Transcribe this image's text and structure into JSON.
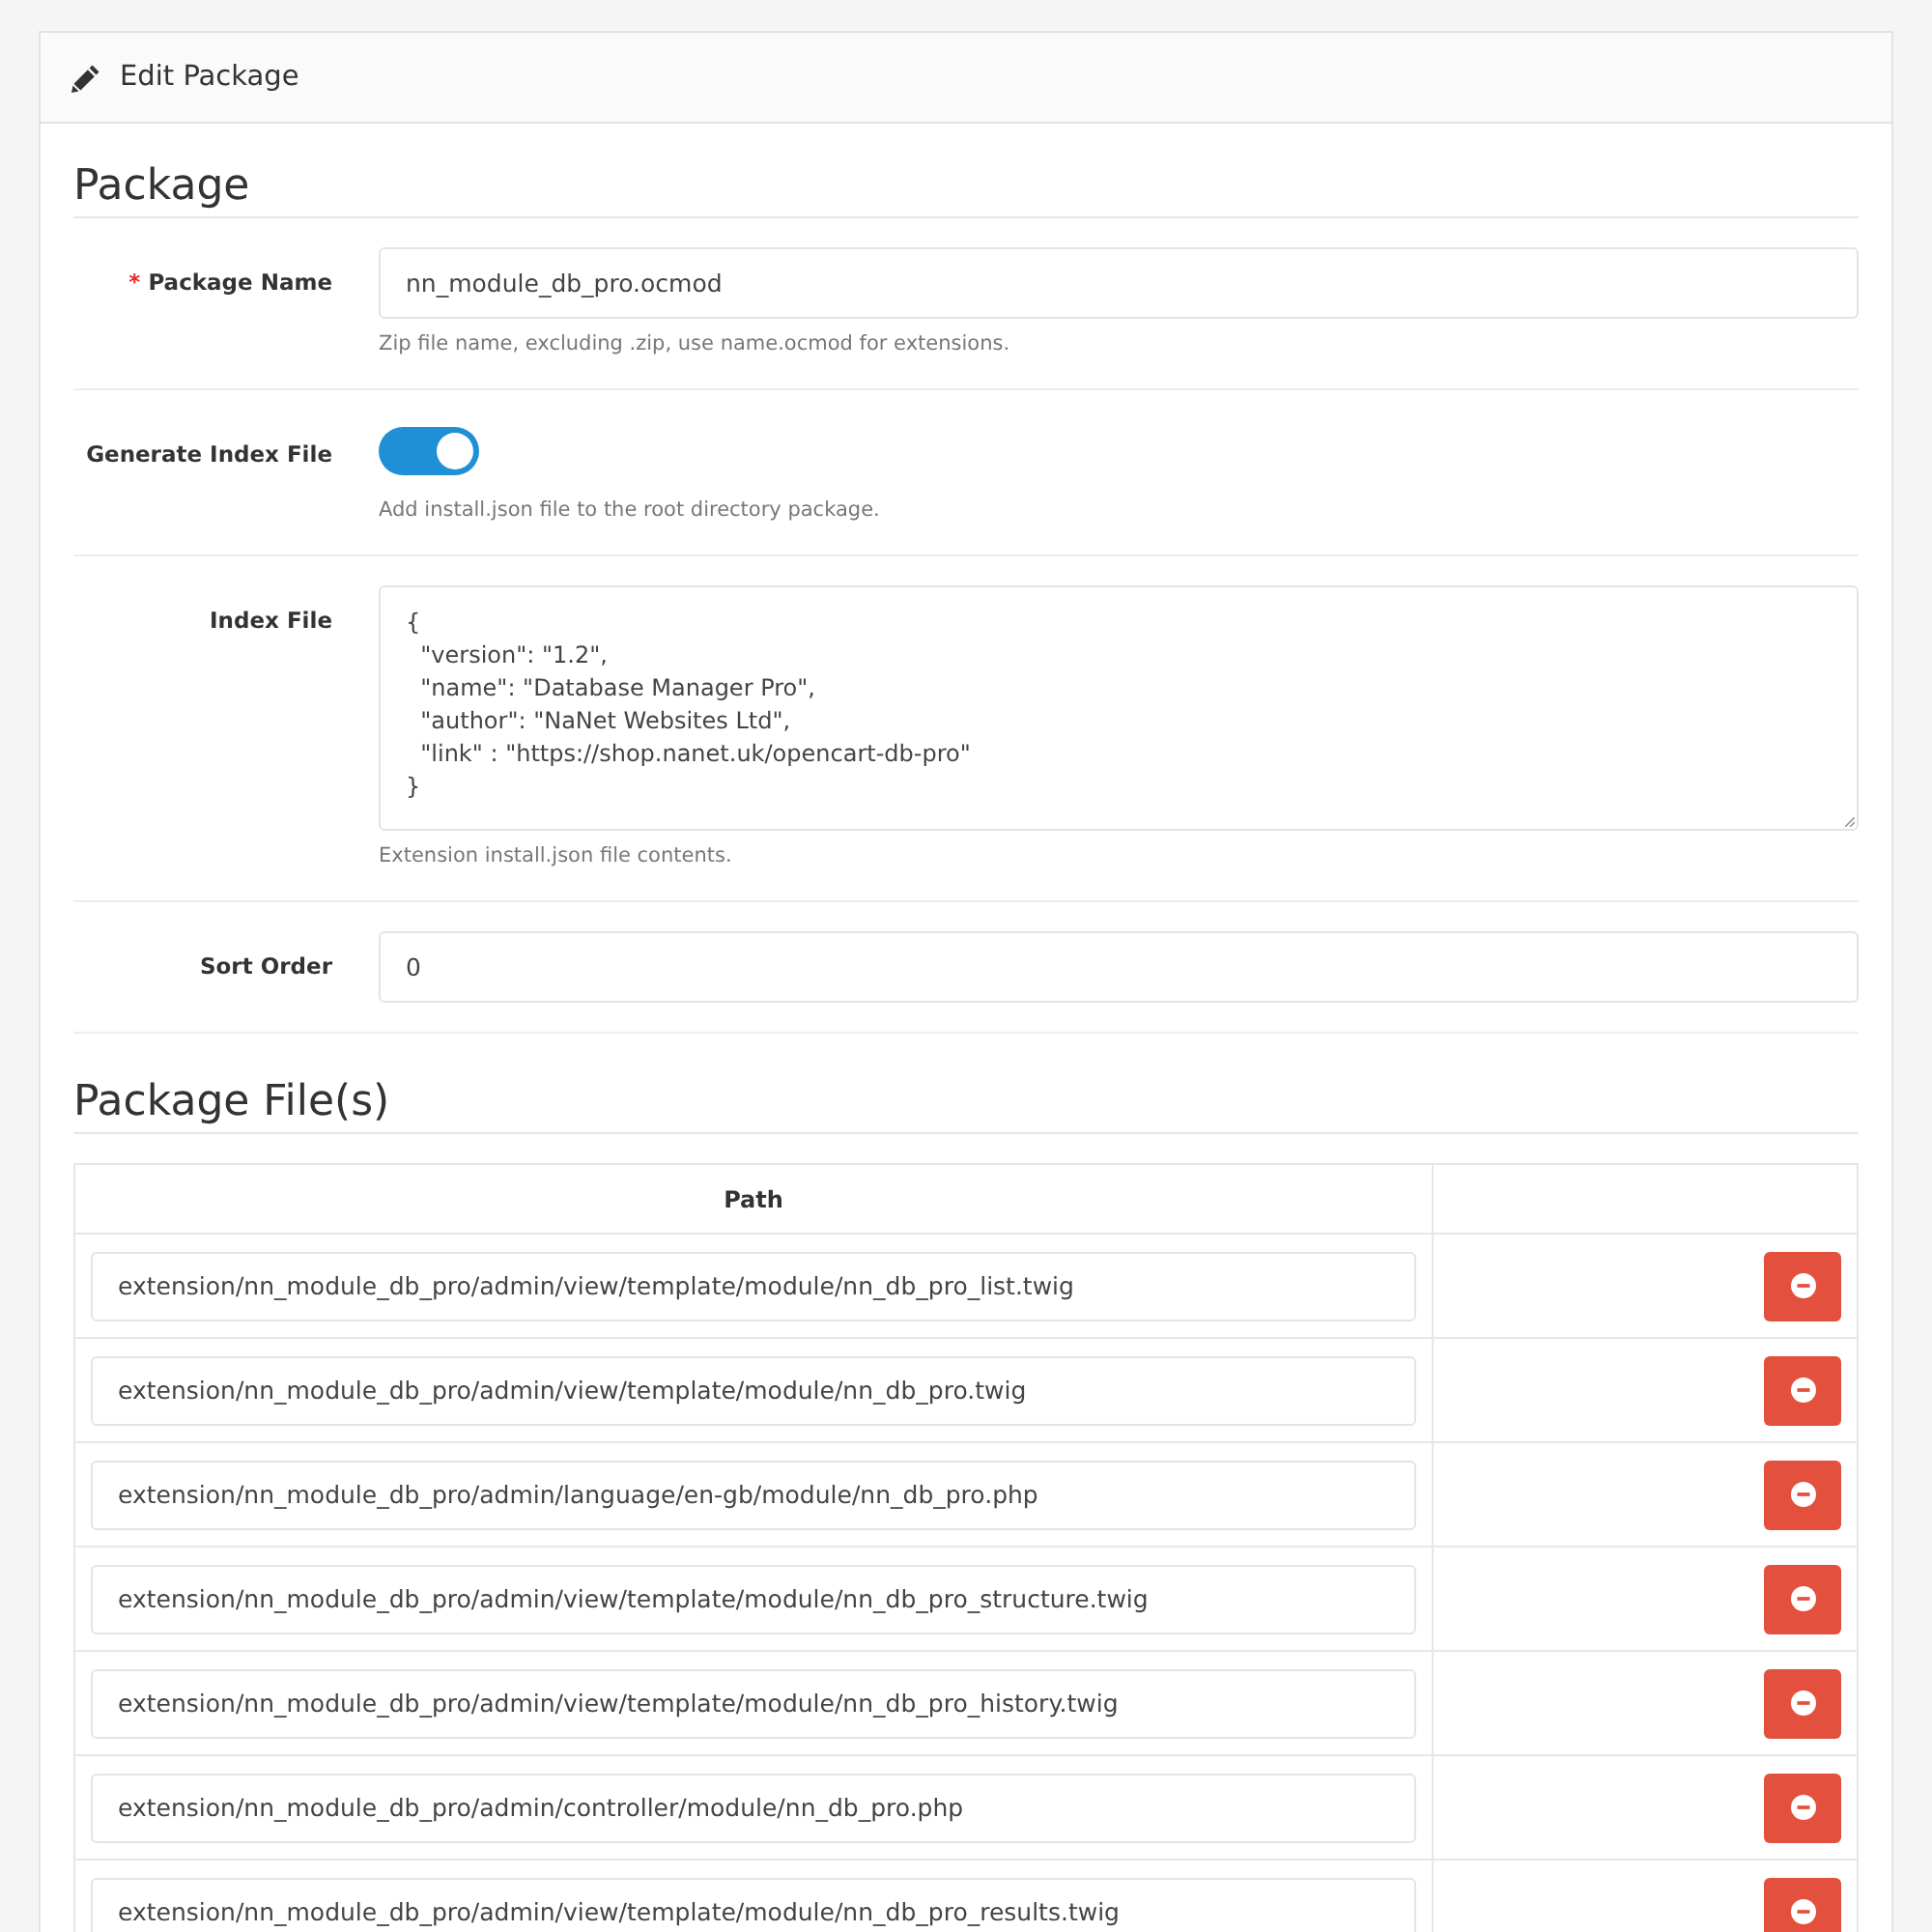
{
  "panel": {
    "title": "Edit Package"
  },
  "package_section": {
    "heading": "Package",
    "fields": [
      {
        "kind": "text",
        "label": "Package Name",
        "required_mark": "*",
        "value": "nn_module_db_pro.ocmod",
        "help": "Zip file name, excluding .zip, use name.ocmod for extensions."
      },
      {
        "kind": "toggle",
        "label": "Generate Index File",
        "on": true,
        "help": "Add install.json file to the root directory package."
      },
      {
        "kind": "textarea",
        "label": "Index File",
        "value": "{\n  \"version\": \"1.2\",\n  \"name\": \"Database Manager Pro\",\n  \"author\": \"NaNet Websites Ltd\",\n  \"link\" : \"https://shop.nanet.uk/opencart-db-pro\"\n}",
        "help": "Extension install.json file contents."
      },
      {
        "kind": "text",
        "label": "Sort Order",
        "value": "0"
      }
    ]
  },
  "files_section": {
    "heading": "Package File(s)",
    "table": {
      "columns": [
        "Path"
      ],
      "rows": [
        {
          "path": "extension/nn_module_db_pro/admin/view/template/module/nn_db_pro_list.twig"
        },
        {
          "path": "extension/nn_module_db_pro/admin/view/template/module/nn_db_pro.twig"
        },
        {
          "path": "extension/nn_module_db_pro/admin/language/en-gb/module/nn_db_pro.php"
        },
        {
          "path": "extension/nn_module_db_pro/admin/view/template/module/nn_db_pro_structure.twig"
        },
        {
          "path": "extension/nn_module_db_pro/admin/view/template/module/nn_db_pro_history.twig"
        },
        {
          "path": "extension/nn_module_db_pro/admin/controller/module/nn_db_pro.php"
        },
        {
          "path": "extension/nn_module_db_pro/admin/view/template/module/nn_db_pro_results.twig"
        }
      ]
    }
  }
}
